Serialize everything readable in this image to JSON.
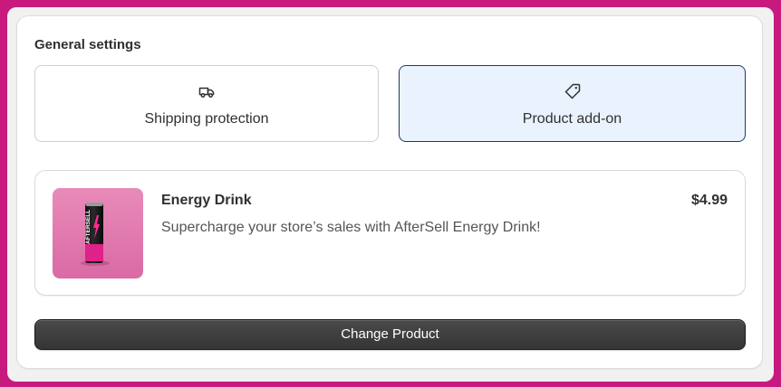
{
  "section": {
    "title": "General settings"
  },
  "options": [
    {
      "label": "Shipping protection",
      "icon": "truck-icon",
      "selected": false
    },
    {
      "label": "Product add-on",
      "icon": "tag-icon",
      "selected": true
    }
  ],
  "product": {
    "name": "Energy Drink",
    "description": "Supercharge your store’s sales with AfterSell Energy Drink!",
    "price": "$4.99",
    "image_icon": "energy-drink-can-image",
    "can_text": "AFTERSELL"
  },
  "actions": {
    "change_product_label": "Change Product"
  },
  "colors": {
    "background": "#c8197e",
    "selected_border": "#1f3b63",
    "selected_fill": "#eaf2fe",
    "button": "#3a3a3a"
  }
}
